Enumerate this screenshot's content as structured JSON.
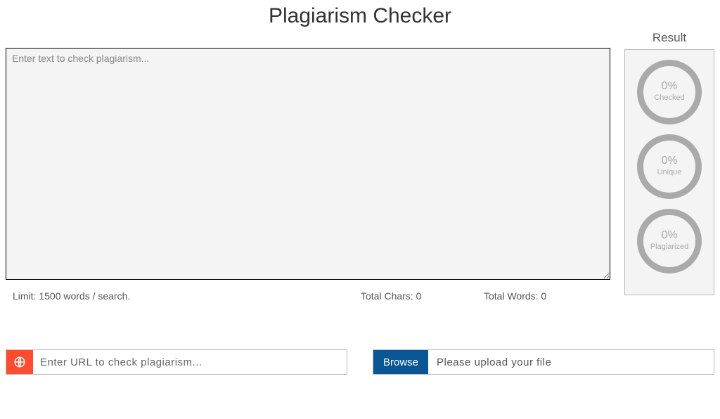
{
  "title": "Plagiarism Checker",
  "textarea": {
    "placeholder": "Enter text to check plagiarism...",
    "value": ""
  },
  "stats": {
    "limit": "Limit: 1500 words / search.",
    "chars": "Total Chars: 0",
    "words": "Total Words: 0"
  },
  "result": {
    "heading": "Result",
    "gauges": [
      {
        "pct": "0%",
        "label": "Checked"
      },
      {
        "pct": "0%",
        "label": "Unique"
      },
      {
        "pct": "0%",
        "label": "Plagiarized"
      }
    ]
  },
  "url_input": {
    "placeholder": "Enter URL to check plagiarism..."
  },
  "upload": {
    "button": "Browse",
    "hint": "Please upload your file"
  }
}
